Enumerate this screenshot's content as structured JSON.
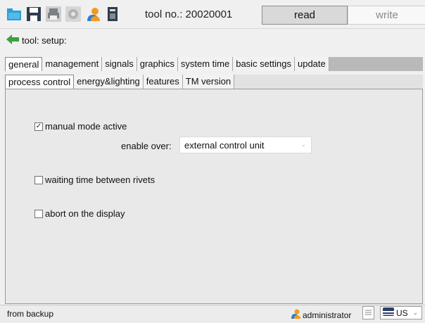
{
  "toolbar": {
    "icons": [
      "folder-icon",
      "save-icon",
      "print-icon",
      "settings-icon",
      "user-icon",
      "device-icon"
    ],
    "tool_no": "tool no.: 20020001",
    "read_label": "read",
    "write_label": "write"
  },
  "breadcrumb": {
    "text": "tool: setup:"
  },
  "tabs_primary": [
    "general",
    "management",
    "signals",
    "graphics",
    "system time",
    "basic settings",
    "update"
  ],
  "tabs_secondary": [
    "process control",
    "energy&lighting",
    "features",
    "TM version"
  ],
  "content": {
    "manual_mode": {
      "label": "manual mode active",
      "checked": true
    },
    "enable_over": {
      "label": "enable over:",
      "value": "external control unit"
    },
    "waiting_time": {
      "label": "waiting time between rivets",
      "checked": false
    },
    "abort_display": {
      "label": "abort on the display",
      "checked": false
    }
  },
  "statusbar": {
    "left_text": "from backup",
    "user": "administrator",
    "language": "US"
  },
  "colors": {
    "folder": "#2a9fd6",
    "back_arrow": "#3aa040",
    "user_orange": "#f39a1e",
    "user_blue": "#2f7fcf"
  }
}
